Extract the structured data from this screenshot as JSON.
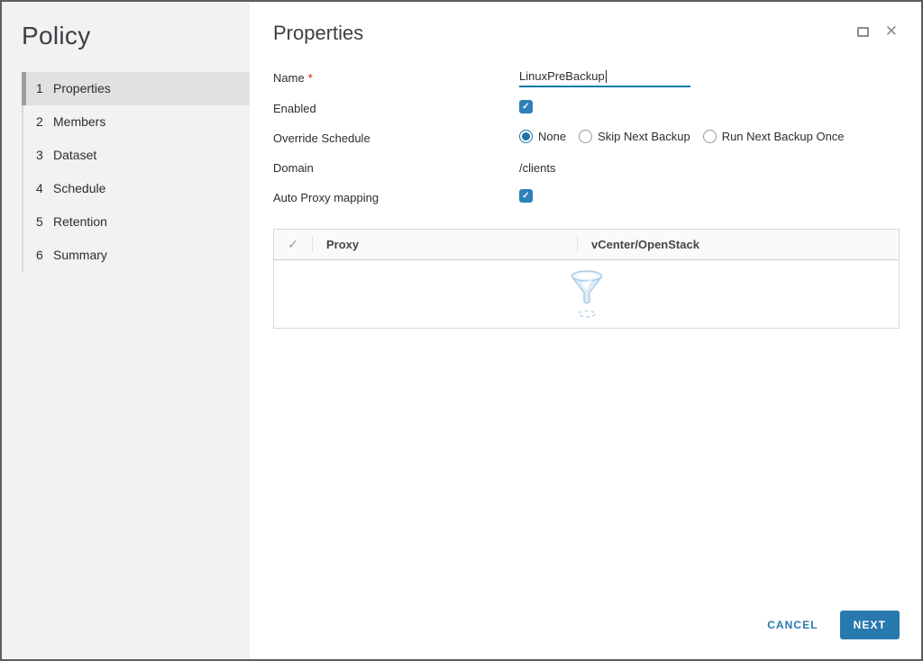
{
  "dialog": {
    "sidebar": {
      "title": "Policy",
      "steps": [
        {
          "number": "1",
          "label": "Properties",
          "active": true
        },
        {
          "number": "2",
          "label": "Members",
          "active": false
        },
        {
          "number": "3",
          "label": "Dataset",
          "active": false
        },
        {
          "number": "4",
          "label": "Schedule",
          "active": false
        },
        {
          "number": "5",
          "label": "Retention",
          "active": false
        },
        {
          "number": "6",
          "label": "Summary",
          "active": false
        }
      ]
    },
    "header": {
      "title": "Properties"
    },
    "form": {
      "name": {
        "label": "Name",
        "required_marker": "*",
        "value": "LinuxPreBackup"
      },
      "enabled": {
        "label": "Enabled",
        "checked": true
      },
      "override_schedule": {
        "label": "Override Schedule",
        "options": [
          {
            "label": "None",
            "selected": true
          },
          {
            "label": "Skip Next Backup",
            "selected": false
          },
          {
            "label": "Run Next Backup Once",
            "selected": false
          }
        ]
      },
      "domain": {
        "label": "Domain",
        "value": "/clients"
      },
      "auto_proxy": {
        "label": "Auto Proxy mapping",
        "checked": true
      }
    },
    "proxy_table": {
      "columns": [
        {
          "label": "",
          "icon": "checkmark-icon"
        },
        {
          "label": "Proxy"
        },
        {
          "label": "vCenter/OpenStack"
        }
      ],
      "rows": [],
      "empty_state_icon": "filter-funnel-icon"
    },
    "footer": {
      "cancel_label": "CANCEL",
      "next_label": "NEXT"
    },
    "icons": {
      "checkmark": "✓",
      "close": "✕"
    },
    "colors": {
      "accent_blue": "#2879ae",
      "checkbox_blue": "#2e80b9",
      "radio_blue": "#1d73a8",
      "input_underline_blue": "#0079ad",
      "required_red": "#c92100",
      "sidebar_bg": "#f2f2f2",
      "active_step_bg": "#e1e1e1",
      "active_step_bar": "#9e9e9e",
      "dialog_border": "#5d5d5d",
      "table_border": "#d9d9d9",
      "funnel_blue": "#a9cbe4"
    }
  }
}
